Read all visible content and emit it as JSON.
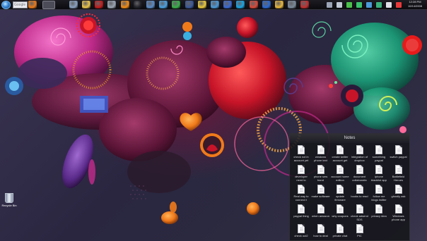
{
  "search": {
    "placeholder": "Google"
  },
  "taskbar": {
    "icons": [
      {
        "name": "firefox-icon",
        "color": "#e87a1a"
      },
      {
        "name": "window-icon",
        "color": "#8aa0c0"
      },
      {
        "name": "folder-icon",
        "color": "#e6c24a"
      },
      {
        "name": "filezilla-icon",
        "color": "#c41c1c"
      },
      {
        "name": "settings-icon",
        "color": "#9aa4b4"
      },
      {
        "name": "vlc-icon",
        "color": "#f08c14"
      },
      {
        "name": "terminal-icon",
        "color": "#202028"
      },
      {
        "name": "network-icon",
        "color": "#5a8ac4"
      },
      {
        "name": "chat-icon",
        "color": "#4aa0e0"
      },
      {
        "name": "messenger-icon",
        "color": "#3ab04a"
      },
      {
        "name": "facebook-icon",
        "color": "#3b5998"
      },
      {
        "name": "mail-icon",
        "color": "#e8c83a"
      },
      {
        "name": "weather-icon",
        "color": "#4a9ad8"
      },
      {
        "name": "download-icon",
        "color": "#3a6ad0"
      },
      {
        "name": "skype-icon",
        "color": "#1aa4e0"
      },
      {
        "name": "chrome-icon",
        "color": "#d84a3a"
      },
      {
        "name": "media-player-icon",
        "color": "#2a6ad0"
      },
      {
        "name": "archive-icon",
        "color": "#e8b83a"
      },
      {
        "name": "tool-icon",
        "color": "#7a8a9a"
      },
      {
        "name": "game-icon",
        "color": "#c03030"
      }
    ]
  },
  "tray": {
    "icons": [
      "phone-icon",
      "speaker-icon",
      "network-tray-icon",
      "shield-icon",
      "sync-icon",
      "chart-icon",
      "mail-tray-icon",
      "flag-icon"
    ],
    "time": "12:28 PM",
    "date": "10/14/2008"
  },
  "desktop": {
    "recycle_bin_label": "Recycle Bin"
  },
  "notes": {
    "title": "Notes",
    "items": [
      {
        "label": "check not in account yet"
      },
      {
        "label": "windows phone text"
      },
      {
        "label": "create twitter account get"
      },
      {
        "label": "integration of dropbox"
      },
      {
        "label": "something paypal"
      },
      {
        "label": "switch paypal"
      },
      {
        "label": "developer need to"
      },
      {
        "label": "phone sms band"
      },
      {
        "label": "account home edition"
      },
      {
        "label": "document collaboratio"
      },
      {
        "label": "iphone blacklist app"
      },
      {
        "label": "Battlefield Heroes"
      },
      {
        "label": "Real way to connect t"
      },
      {
        "label": "make software"
      },
      {
        "label": "update firmware"
      },
      {
        "label": "books to read"
      },
      {
        "label": "follow me blogs twitter"
      },
      {
        "label": "ghostly ask"
      },
      {
        "label": "paypal thing"
      },
      {
        "label": "when amazon"
      },
      {
        "label": "why coupons"
      },
      {
        "label": "check adsend SDS"
      },
      {
        "label": "privacy idea"
      },
      {
        "label": "Windows phone app"
      },
      {
        "label": "check out2"
      },
      {
        "label": "how to deal"
      },
      {
        "label": "private chat"
      },
      {
        "label": "PIC"
      }
    ]
  }
}
